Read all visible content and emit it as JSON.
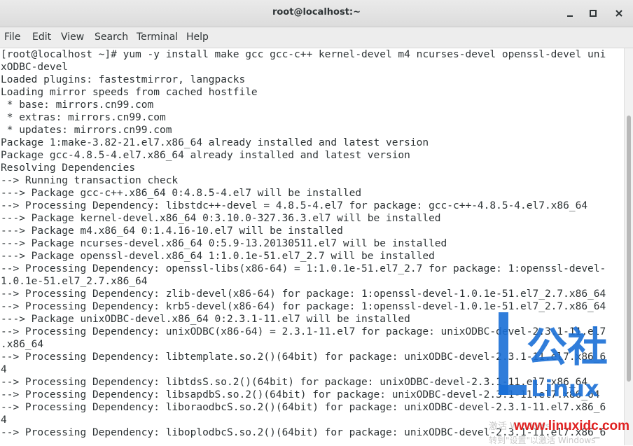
{
  "window": {
    "title": "root@localhost:~",
    "controls": {
      "minimize": "–",
      "maximize": "□",
      "close": "✕"
    }
  },
  "menu": [
    "File",
    "Edit",
    "View",
    "Search",
    "Terminal",
    "Help"
  ],
  "terminal": {
    "lines": [
      "[root@localhost ~]# yum -y install make gcc gcc-c++ kernel-devel m4 ncurses-devel openssl-devel uni",
      "xODBC-devel",
      "Loaded plugins: fastestmirror, langpacks",
      "Loading mirror speeds from cached hostfile",
      " * base: mirrors.cn99.com",
      " * extras: mirrors.cn99.com",
      " * updates: mirrors.cn99.com",
      "Package 1:make-3.82-21.el7.x86_64 already installed and latest version",
      "Package gcc-4.8.5-4.el7.x86_64 already installed and latest version",
      "Resolving Dependencies",
      "--> Running transaction check",
      "---> Package gcc-c++.x86_64 0:4.8.5-4.el7 will be installed",
      "--> Processing Dependency: libstdc++-devel = 4.8.5-4.el7 for package: gcc-c++-4.8.5-4.el7.x86_64",
      "---> Package kernel-devel.x86_64 0:3.10.0-327.36.3.el7 will be installed",
      "---> Package m4.x86_64 0:1.4.16-10.el7 will be installed",
      "---> Package ncurses-devel.x86_64 0:5.9-13.20130511.el7 will be installed",
      "---> Package openssl-devel.x86_64 1:1.0.1e-51.el7_2.7 will be installed",
      "--> Processing Dependency: openssl-libs(x86-64) = 1:1.0.1e-51.el7_2.7 for package: 1:openssl-devel-",
      "1.0.1e-51.el7_2.7.x86_64",
      "--> Processing Dependency: zlib-devel(x86-64) for package: 1:openssl-devel-1.0.1e-51.el7_2.7.x86_64",
      "--> Processing Dependency: krb5-devel(x86-64) for package: 1:openssl-devel-1.0.1e-51.el7_2.7.x86_64",
      "---> Package unixODBC-devel.x86_64 0:2.3.1-11.el7 will be installed",
      "--> Processing Dependency: unixODBC(x86-64) = 2.3.1-11.el7 for package: unixODBC-devel-2.3.1-11.el7",
      ".x86_64",
      "--> Processing Dependency: libtemplate.so.2()(64bit) for package: unixODBC-devel-2.3.1-11.el7.x86_6",
      "4",
      "--> Processing Dependency: libtdsS.so.2()(64bit) for package: unixODBC-devel-2.3.1-11.el7.x86_64",
      "--> Processing Dependency: libsapdbS.so.2()(64bit) for package: unixODBC-devel-2.3.1-11.el7.x86_64",
      "--> Processing Dependency: liboraodbcS.so.2()(64bit) for package: unixODBC-devel-2.3.1-11.el7.x86_6",
      "4",
      "--> Processing Dependency: liboplodbcS.so.2()(64bit) for package: unixODBC-devel-2.3.1-11.el7.x86_6"
    ]
  },
  "watermark": {
    "logo_text": "公社",
    "logo_sub": "Linux",
    "activate_line1": "激活 Windows",
    "activate_line2": "转到\"设置\"以激活 Windows",
    "url": "www.linuxidc.com"
  },
  "colors": {
    "text": "#2e3436",
    "logo_blue": "#1a6fd6",
    "url_red": "#e02020"
  }
}
